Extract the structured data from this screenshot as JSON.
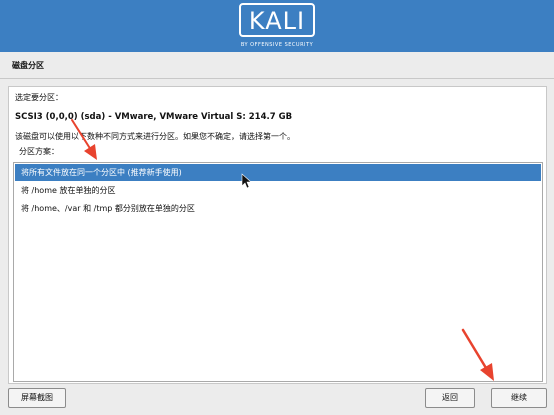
{
  "header": {
    "logo_text": "KALI",
    "logo_tagline": "BY OFFENSIVE SECURITY",
    "brand_color": "#3c7fc2"
  },
  "section": {
    "title": "磁盘分区"
  },
  "main": {
    "prompt": "选定要分区：",
    "disk": "SCSI3 (0,0,0) (sda) - VMware, VMware Virtual S: 214.7 GB",
    "info": "该磁盘可以使用以下数种不同方式来进行分区。如果您不确定，请选择第一个。",
    "scheme_label": "分区方案：",
    "options": [
      {
        "label": "将所有文件放在同一个分区中 (推荐新手使用)",
        "selected": true
      },
      {
        "label": "将 /home 放在单独的分区",
        "selected": false
      },
      {
        "label": "将 /home、/var 和 /tmp 都分别放在单独的分区",
        "selected": false
      }
    ]
  },
  "buttons": {
    "screenshot": "屏幕截图",
    "back": "返回",
    "continue": "继续"
  },
  "annotations": {
    "arrow_color": "#e8432e",
    "cursor_icon": "mouse-pointer-icon"
  }
}
